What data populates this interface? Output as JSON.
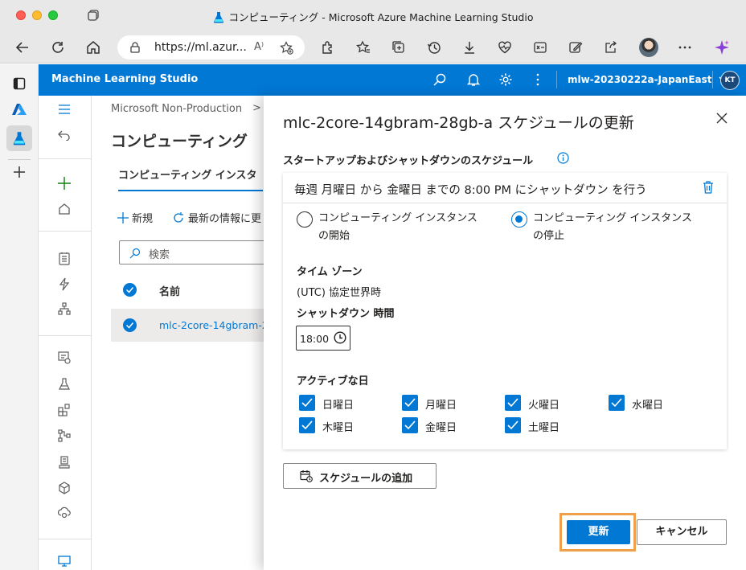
{
  "window": {
    "title": "コンピューティング - Microsoft Azure Machine Learning Studio",
    "url": "https://ml.azur...",
    "read_aloud": "A⁾"
  },
  "header": {
    "brand": "Machine Learning Studio",
    "workspace": "mlw-20230222a-JapanEast",
    "user_initials": "KT"
  },
  "background_page": {
    "breadcrumb": "Microsoft Non-Production",
    "breadcrumb_sep": ">",
    "title": "コンピューティング",
    "tab_active": "コンピューティング インスタ",
    "new_label": "新規",
    "refresh_label": "最新の情報に更",
    "search_placeholder": "検索",
    "col_name": "名前",
    "row_name": "mlc-2core-14gbram-2"
  },
  "panel": {
    "title": "mlc-2core-14gbram-28gb-a スケジュールの更新",
    "section_label": "スタートアップおよびシャットダウンのスケジュール",
    "schedule_summary": "毎週 月曜日 から 金曜日 までの 8:00 PM にシャットダウン を行う",
    "radio_start_line1": "コンピューティング インスタンス",
    "radio_start_line2": "の開始",
    "radio_stop_line1": "コンピューティング インスタンス",
    "radio_stop_line2": "の停止",
    "selected_action": "stop",
    "timezone_label": "タイム ゾーン",
    "timezone_value": "(UTC) 協定世界時",
    "shutdown_time_label": "シャットダウン 時間",
    "shutdown_time_value": "18:00",
    "active_days_label": "アクティブな日",
    "days": [
      {
        "label": "日曜日",
        "checked": true
      },
      {
        "label": "月曜日",
        "checked": true
      },
      {
        "label": "火曜日",
        "checked": true
      },
      {
        "label": "水曜日",
        "checked": true
      },
      {
        "label": "木曜日",
        "checked": true
      },
      {
        "label": "金曜日",
        "checked": true
      },
      {
        "label": "土曜日",
        "checked": true
      }
    ],
    "add_schedule_label": "スケジュールの追加",
    "update_label": "更新",
    "cancel_label": "キャンセル"
  },
  "colors": {
    "azure_blue": "#0078d4",
    "highlight": "#f0a04b"
  }
}
